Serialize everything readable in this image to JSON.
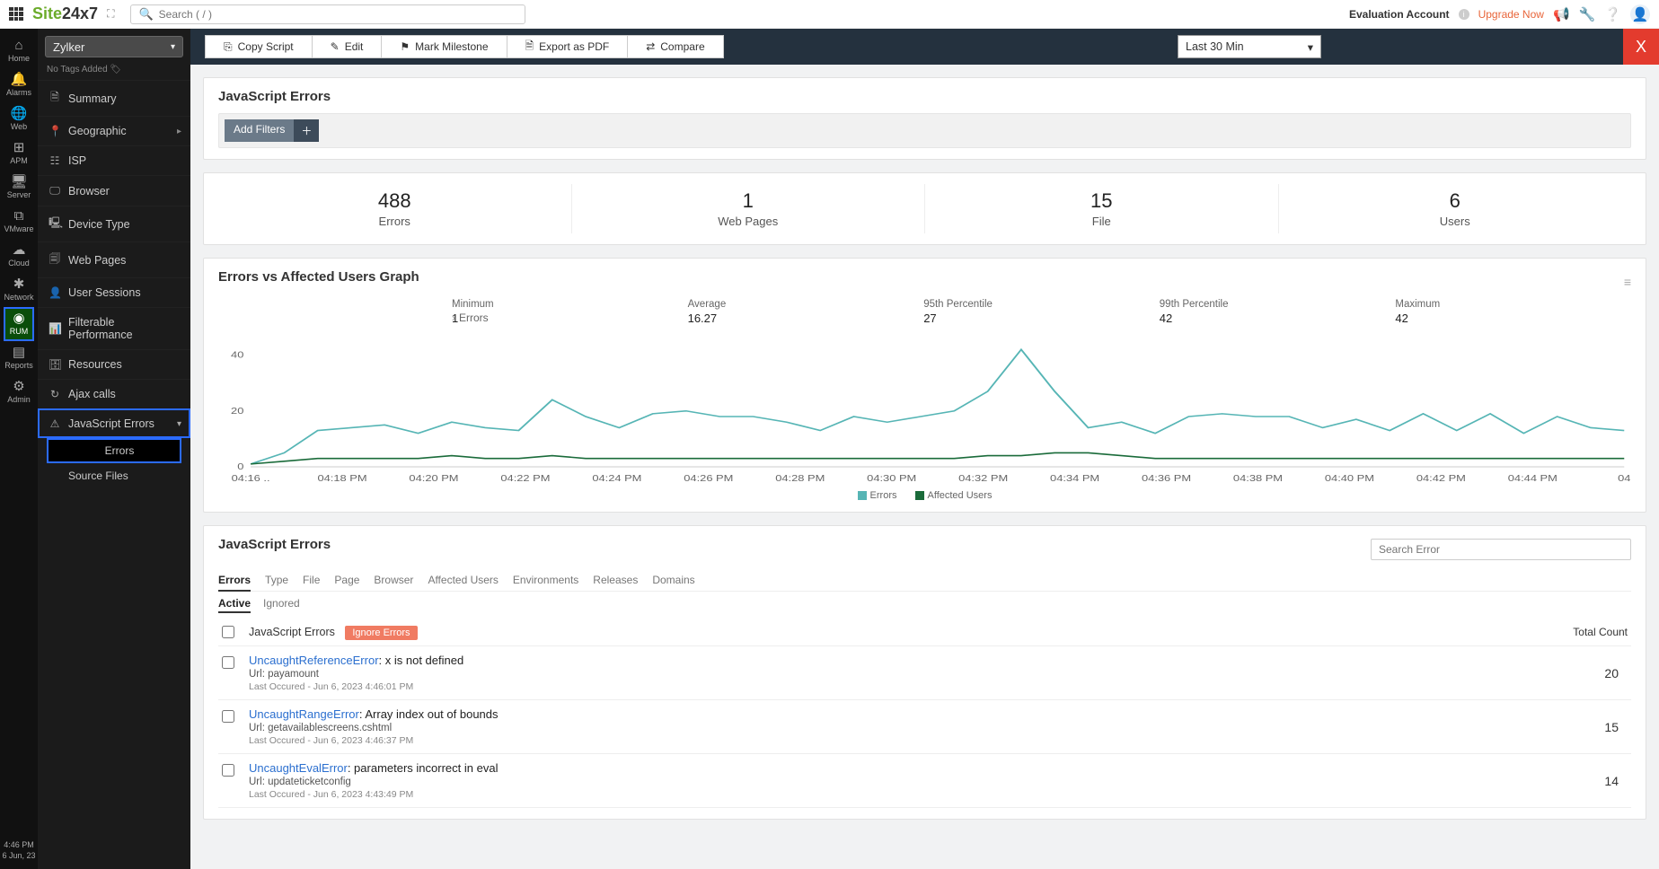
{
  "header": {
    "logo": {
      "part1": "Site",
      "part2": "24x7"
    },
    "search_placeholder": "Search ( / )",
    "account_label": "Evaluation Account",
    "upgrade_label": "Upgrade Now"
  },
  "rail": {
    "items": [
      {
        "icon": "⌂",
        "label": "Home"
      },
      {
        "icon": "🔔",
        "label": "Alarms"
      },
      {
        "icon": "🌐",
        "label": "Web"
      },
      {
        "icon": "⊞",
        "label": "APM"
      },
      {
        "icon": "🖥",
        "label": "Server"
      },
      {
        "icon": "⧉",
        "label": "VMware"
      },
      {
        "icon": "☁",
        "label": "Cloud"
      },
      {
        "icon": "✱",
        "label": "Network"
      },
      {
        "icon": "◉",
        "label": "RUM"
      },
      {
        "icon": "▤",
        "label": "Reports"
      },
      {
        "icon": "⚙",
        "label": "Admin"
      }
    ],
    "footer": {
      "time": "4:46 PM",
      "date": "6 Jun, 23"
    }
  },
  "sidebar": {
    "selected_app": "Zylker",
    "no_tags": "No Tags Added",
    "items": [
      {
        "icon": "🗎",
        "label": "Summary"
      },
      {
        "icon": "📍",
        "label": "Geographic",
        "expandable": true
      },
      {
        "icon": "☷",
        "label": "ISP"
      },
      {
        "icon": "🖵",
        "label": "Browser"
      },
      {
        "icon": "🖳",
        "label": "Device Type"
      },
      {
        "icon": "🗐",
        "label": "Web Pages"
      },
      {
        "icon": "👤",
        "label": "User Sessions"
      },
      {
        "icon": "📊",
        "label": "Filterable Performance"
      },
      {
        "icon": "🗄",
        "label": "Resources"
      },
      {
        "icon": "↻",
        "label": "Ajax calls"
      },
      {
        "icon": "⚠",
        "label": "JavaScript Errors",
        "active_parent": true
      }
    ],
    "subs": [
      {
        "label": "Errors",
        "active": true
      },
      {
        "label": "Source Files"
      }
    ]
  },
  "toolbar": {
    "copy": "Copy Script",
    "edit": "Edit",
    "milestone": "Mark Milestone",
    "pdf": "Export as PDF",
    "compare": "Compare",
    "time_range": "Last 30 Min",
    "close": "X"
  },
  "page": {
    "title": "JavaScript Errors",
    "add_filters": "Add Filters",
    "stats": [
      {
        "num": "488",
        "lbl": "Errors"
      },
      {
        "num": "1",
        "lbl": "Web Pages"
      },
      {
        "num": "15",
        "lbl": "File"
      },
      {
        "num": "6",
        "lbl": "Users"
      }
    ]
  },
  "chart_panel": {
    "title": "Errors vs Affected Users Graph",
    "caret_label": "Errors",
    "metrics": [
      {
        "h": "Minimum",
        "v": "1"
      },
      {
        "h": "Average",
        "v": "16.27"
      },
      {
        "h": "95th Percentile",
        "v": "27"
      },
      {
        "h": "99th Percentile",
        "v": "42"
      },
      {
        "h": "Maximum",
        "v": "42"
      }
    ],
    "legend": [
      {
        "color": "#56b5b5",
        "label": "Errors"
      },
      {
        "color": "#1a6b3a",
        "label": "Affected Users"
      }
    ]
  },
  "chart_data": {
    "type": "line",
    "x_ticks": [
      "04:16 ..",
      "04:18 PM",
      "04:20 PM",
      "04:22 PM",
      "04:24 PM",
      "04:26 PM",
      "04:28 PM",
      "04:30 PM",
      "04:32 PM",
      "04:34 PM",
      "04:36 PM",
      "04:38 PM",
      "04:40 PM",
      "04:42 PM",
      "04:44 PM",
      "04"
    ],
    "y_ticks": [
      0,
      20,
      40
    ],
    "ylim": [
      0,
      45
    ],
    "title": "Errors vs Affected Users Graph",
    "series": [
      {
        "name": "Errors",
        "color": "#56b5b5",
        "values": [
          1,
          5,
          13,
          14,
          15,
          12,
          16,
          14,
          13,
          24,
          18,
          14,
          19,
          20,
          18,
          18,
          16,
          13,
          18,
          16,
          18,
          20,
          27,
          42,
          27,
          14,
          16,
          12,
          18,
          19,
          18,
          18,
          14,
          17,
          13,
          19,
          13,
          19,
          12,
          18,
          14,
          13
        ]
      },
      {
        "name": "Affected Users",
        "color": "#1a6b3a",
        "values": [
          1,
          2,
          3,
          3,
          3,
          3,
          4,
          3,
          3,
          4,
          3,
          3,
          3,
          3,
          3,
          3,
          3,
          3,
          3,
          3,
          3,
          3,
          4,
          4,
          5,
          5,
          4,
          3,
          3,
          3,
          3,
          3,
          3,
          3,
          3,
          3,
          3,
          3,
          3,
          3,
          3,
          3
        ]
      }
    ]
  },
  "table": {
    "title": "JavaScript Errors",
    "search_placeholder": "Search Error",
    "tabs": [
      "Errors",
      "Type",
      "File",
      "Page",
      "Browser",
      "Affected Users",
      "Environments",
      "Releases",
      "Domains"
    ],
    "subtabs": [
      "Active",
      "Ignored"
    ],
    "head": "JavaScript Errors",
    "ignore": "Ignore Errors",
    "count_head": "Total Count",
    "url_prefix": "Url: ",
    "time_prefix": "Last Occured - ",
    "rows": [
      {
        "name": "UncaughtReferenceError",
        "msg": ": x is not defined",
        "url": "payamount",
        "time": "Jun 6, 2023 4:46:01 PM",
        "count": "20"
      },
      {
        "name": "UncaughtRangeError",
        "msg": ": Array index out of bounds",
        "url": "getavailablescreens.cshtml",
        "time": "Jun 6, 2023 4:46:37 PM",
        "count": "15"
      },
      {
        "name": "UncaughtEvalError",
        "msg": ": parameters incorrect in eval",
        "url": "updateticketconfig",
        "time": "Jun 6, 2023 4:43:49 PM",
        "count": "14"
      }
    ]
  }
}
